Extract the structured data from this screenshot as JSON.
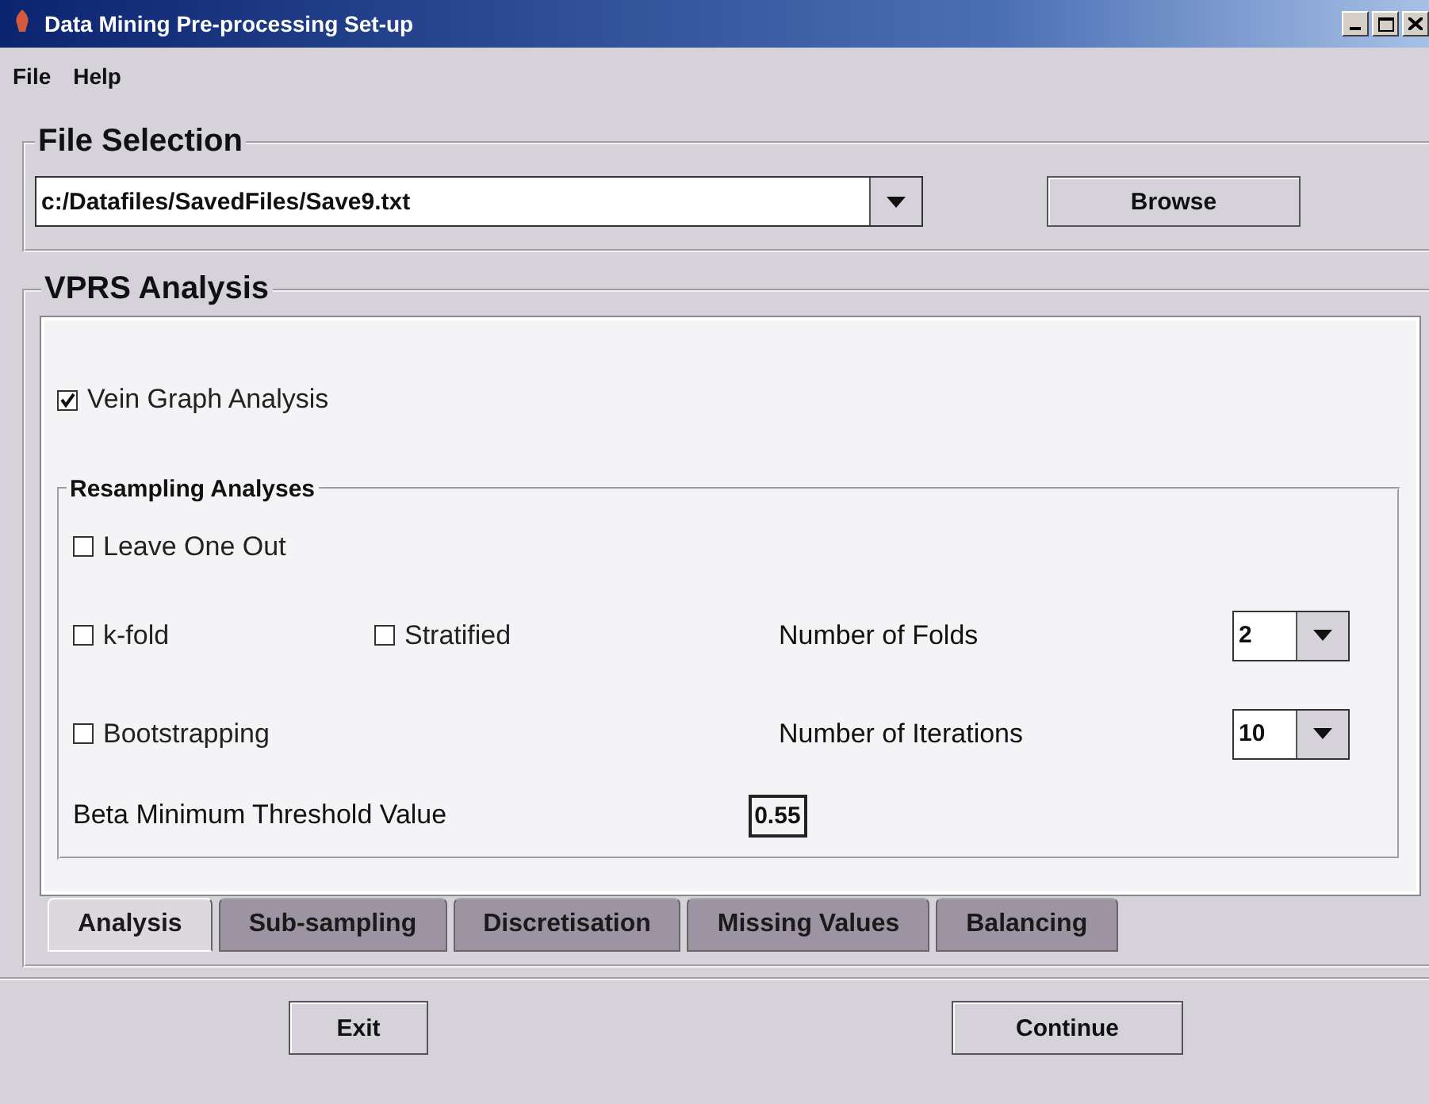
{
  "window": {
    "title": "Data Mining Pre-processing Set-up"
  },
  "menu": [
    "File",
    "Help"
  ],
  "file_selection": {
    "title": "File Selection",
    "path": "c:/Datafiles/SavedFiles/Save9.txt",
    "browse_button": "Browse"
  },
  "vprs_analysis": {
    "title": "VPRS Analysis",
    "vein_graph": {
      "label": "Vein Graph Analysis",
      "checked": true
    },
    "resampling": {
      "title": "Resampling Analyses",
      "leave_one_out": {
        "label": "Leave One Out",
        "checked": false
      },
      "k_fold": {
        "label": "k-fold",
        "checked": false
      },
      "stratified": {
        "label": "Stratified",
        "checked": false
      },
      "bootstrapping": {
        "label": "Bootstrapping",
        "checked": false
      },
      "folds": {
        "label": "Number of Folds",
        "value": "2"
      },
      "iterations": {
        "label": "Number of Iterations",
        "value": "10"
      }
    },
    "beta": {
      "label": "Beta Minimum Threshold Value",
      "value": "0.55"
    }
  },
  "tabs": [
    {
      "label": "Analysis",
      "selected": true
    },
    {
      "label": "Sub-sampling",
      "selected": false
    },
    {
      "label": "Discretisation",
      "selected": false
    },
    {
      "label": "Missing Values",
      "selected": false
    },
    {
      "label": "Balancing",
      "selected": false
    }
  ],
  "buttons": [
    "Exit",
    "Continue"
  ]
}
